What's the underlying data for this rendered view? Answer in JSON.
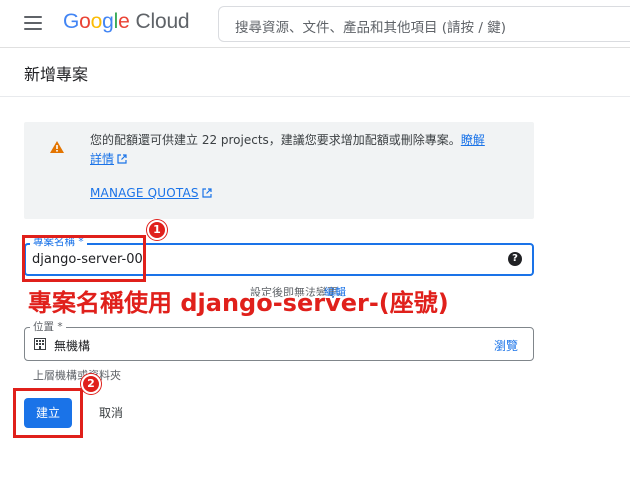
{
  "header": {
    "logo_google": "Google",
    "logo_cloud": "Cloud",
    "search_placeholder": "搜尋資源、文件、產品和其他項目 (請按 / 鍵)"
  },
  "page": {
    "title": "新增專案"
  },
  "quota": {
    "message": "您的配額還可供建立 22 projects，建議您要求增加配額或刪除專案。",
    "learn_more_1": "瞭解",
    "learn_more_2": "詳情",
    "manage_quotas": "MANAGE QUOTAS"
  },
  "project_name": {
    "label": "專案名稱 *",
    "value": "django-server-00",
    "help_symbol": "?"
  },
  "hint": {
    "text": "設定後即無法變更。",
    "edit_link": "編輯"
  },
  "annotation": {
    "text": "專案名稱使用 django-server-(座號)",
    "badge_1": "1",
    "badge_2": "2"
  },
  "location": {
    "label": "位置 *",
    "value": "無機構",
    "browse": "瀏覽",
    "helper": "上層機構或資料夾"
  },
  "actions": {
    "create": "建立",
    "cancel": "取消"
  },
  "colors": {
    "accent": "#1a73e8",
    "annotation_red": "#e0201b",
    "warning": "#e37400"
  }
}
